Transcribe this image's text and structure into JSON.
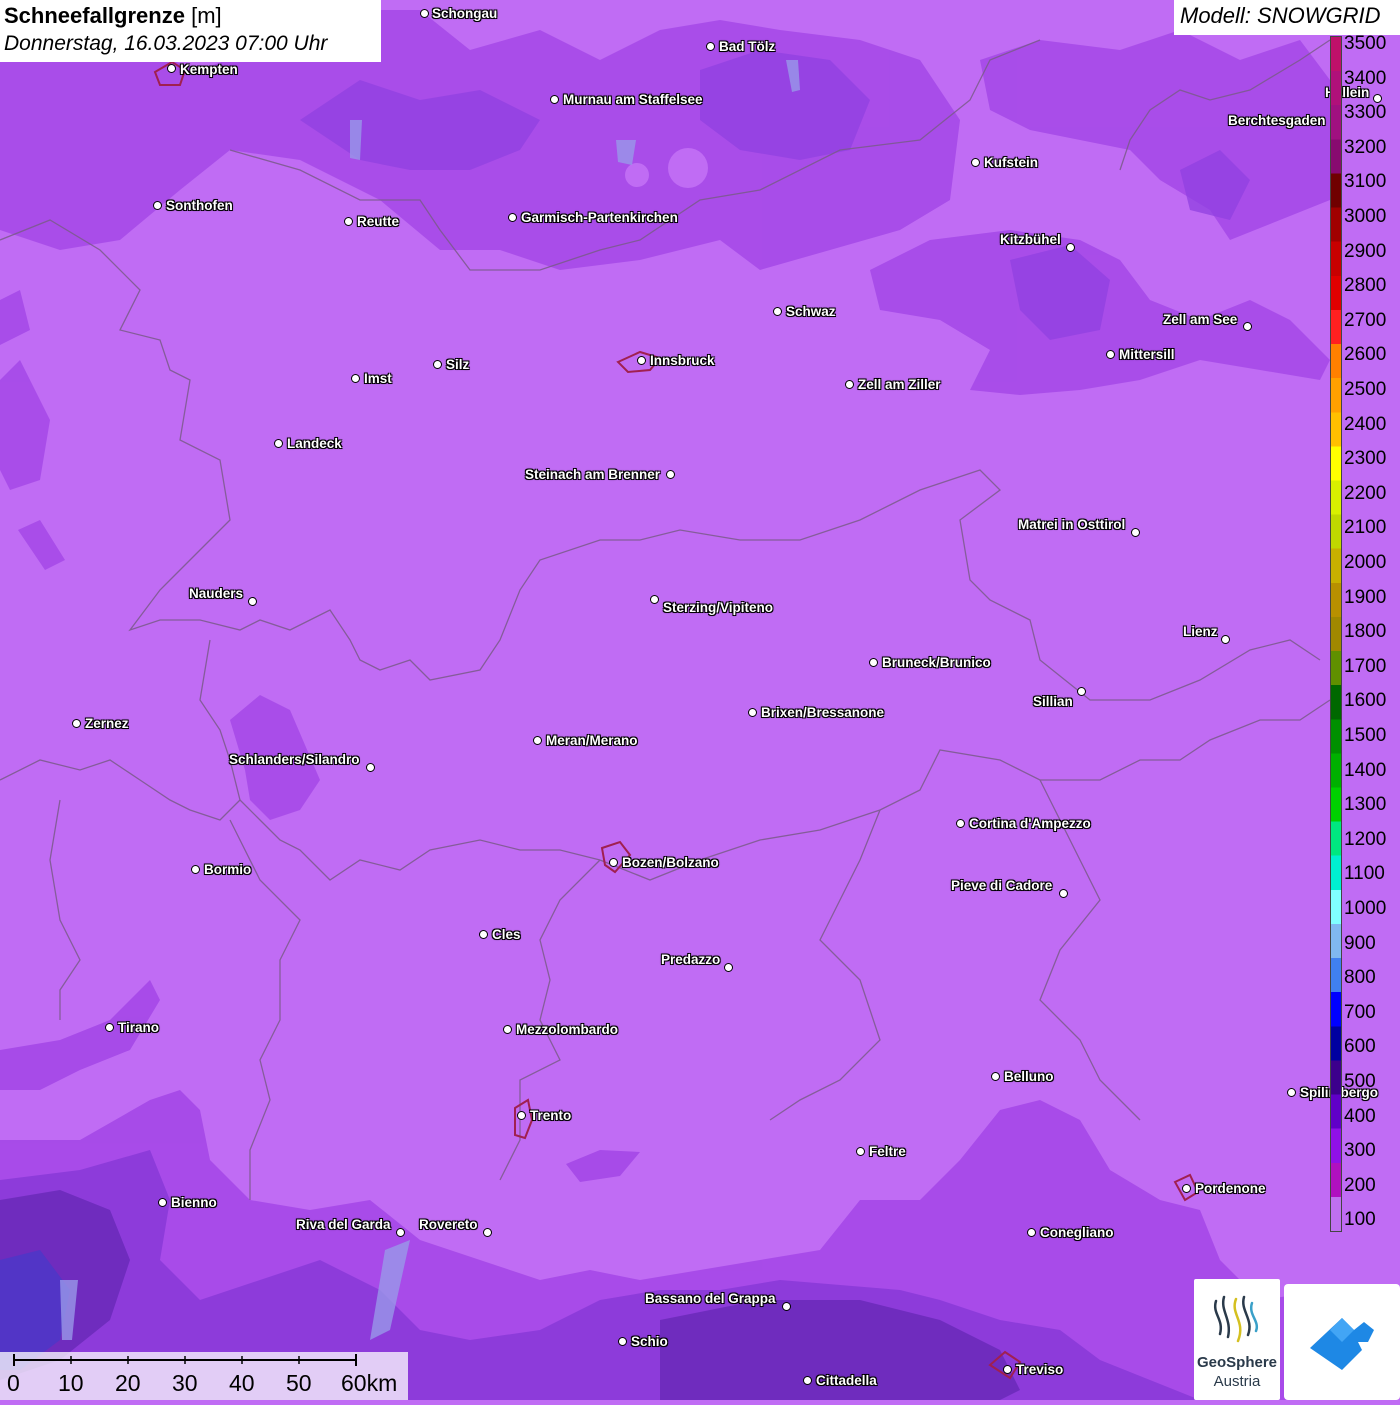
{
  "title": {
    "parameter": "Schneefallgrenze",
    "unit": "[m]",
    "datetime": "Donnerstag, 16.03.2023 07:00 Uhr"
  },
  "model": "Modell: SNOWGRID",
  "legend": {
    "labels": [
      "3500",
      "3400",
      "3300",
      "3200",
      "3100",
      "3000",
      "2900",
      "2800",
      "2700",
      "2600",
      "2500",
      "2400",
      "2300",
      "2200",
      "2100",
      "2000",
      "1900",
      "1800",
      "1700",
      "1600",
      "1500",
      "1400",
      "1300",
      "1200",
      "1100",
      "1000",
      "900",
      "800",
      "700",
      "600",
      "500",
      "400",
      "300",
      "200",
      "100"
    ],
    "colors": [
      "#c0106a",
      "#b0107a",
      "#a01080",
      "#880a70",
      "#700000",
      "#a00000",
      "#c80000",
      "#e00000",
      "#ff2020",
      "#ff8000",
      "#ffa000",
      "#ffc000",
      "#ffff00",
      "#d8f000",
      "#c0d800",
      "#c8b000",
      "#b89000",
      "#a08800",
      "#609000",
      "#006800",
      "#009000",
      "#00b000",
      "#00d000",
      "#00e880",
      "#00f0d0",
      "#80ffff",
      "#80b8f0",
      "#4080f0",
      "#0000ff",
      "#0000a0",
      "#3c008c",
      "#6000c8",
      "#9010e8",
      "#b010c0",
      "#c070f0"
    ]
  },
  "cities": [
    {
      "name": "Schongau"
    },
    {
      "name": "Kempten"
    },
    {
      "name": "Bad Tölz"
    },
    {
      "name": "Murnau am Staffelsee"
    },
    {
      "name": "Berchtesgaden"
    },
    {
      "name": "Hallein"
    },
    {
      "name": "Kufstein"
    },
    {
      "name": "Sonthofen"
    },
    {
      "name": "Reutte"
    },
    {
      "name": "Garmisch-Partenkirchen"
    },
    {
      "name": "Kitzbühel"
    },
    {
      "name": "Schwaz"
    },
    {
      "name": "Zell am See"
    },
    {
      "name": "Innsbruck"
    },
    {
      "name": "Mittersill"
    },
    {
      "name": "Silz"
    },
    {
      "name": "Imst"
    },
    {
      "name": "Zell am Ziller"
    },
    {
      "name": "Landeck"
    },
    {
      "name": "Steinach am Brenner"
    },
    {
      "name": "Matrei in Osttirol"
    },
    {
      "name": "Nauders"
    },
    {
      "name": "Sterzing/Vipiteno"
    },
    {
      "name": "Lienz"
    },
    {
      "name": "Bruneck/Brunico"
    },
    {
      "name": "Sillian"
    },
    {
      "name": "Zernez"
    },
    {
      "name": "Brixen/Bressanone"
    },
    {
      "name": "Meran/Merano"
    },
    {
      "name": "Schlanders/Silandro"
    },
    {
      "name": "Cortina d'Ampezzo"
    },
    {
      "name": "Bozen/Bolzano"
    },
    {
      "name": "Bormio"
    },
    {
      "name": "Pieve di Cadore"
    },
    {
      "name": "Cles"
    },
    {
      "name": "Predazzo"
    },
    {
      "name": "Tirano"
    },
    {
      "name": "Mezzolombardo"
    },
    {
      "name": "Belluno"
    },
    {
      "name": "Spilimbergo"
    },
    {
      "name": "Trento"
    },
    {
      "name": "Feltre"
    },
    {
      "name": "Pordenone"
    },
    {
      "name": "Bienno"
    },
    {
      "name": "Riva del Garda"
    },
    {
      "name": "Rovereto"
    },
    {
      "name": "Conegliano"
    },
    {
      "name": "Bassano del Grappa"
    },
    {
      "name": "Schio"
    },
    {
      "name": "Treviso"
    },
    {
      "name": "Cittadella"
    }
  ],
  "scalebar": {
    "labels": [
      "0",
      "10",
      "20",
      "30",
      "40",
      "50",
      "60km"
    ]
  },
  "logo": {
    "name_line1": "GeoSphere",
    "name_line2": "Austria"
  }
}
